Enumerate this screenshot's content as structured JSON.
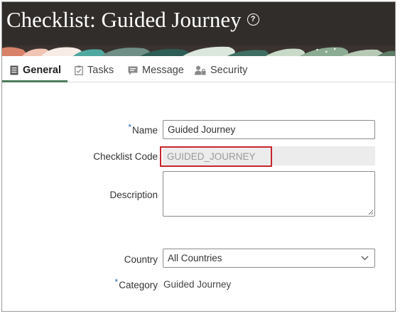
{
  "header": {
    "title": "Checklist: Guided Journey",
    "help_icon": "help-circle-icon"
  },
  "tabs": [
    {
      "label": "General",
      "icon": "document-list-icon",
      "active": true
    },
    {
      "label": "Tasks",
      "icon": "clipboard-icon",
      "active": false
    },
    {
      "label": "Message",
      "icon": "message-icon",
      "active": false
    },
    {
      "label": "Security",
      "icon": "user-lock-icon",
      "active": false
    }
  ],
  "form": {
    "name": {
      "label": "Name",
      "required_marker": "*",
      "value": "Guided Journey"
    },
    "checklist_code": {
      "label": "Checklist Code",
      "value": "GUIDED_JOURNEY"
    },
    "description": {
      "label": "Description",
      "value": ""
    },
    "country": {
      "label": "Country",
      "value": "All Countries"
    },
    "category": {
      "label": "Category",
      "required_marker": "*",
      "value": "Guided Journey"
    }
  },
  "colors": {
    "header_bg": "#312d2a",
    "active_tab_underline": "#4d7b5c",
    "required_marker": "#2a6aa8",
    "highlight_border": "#c8262d",
    "readonly_bg": "#ececec"
  }
}
